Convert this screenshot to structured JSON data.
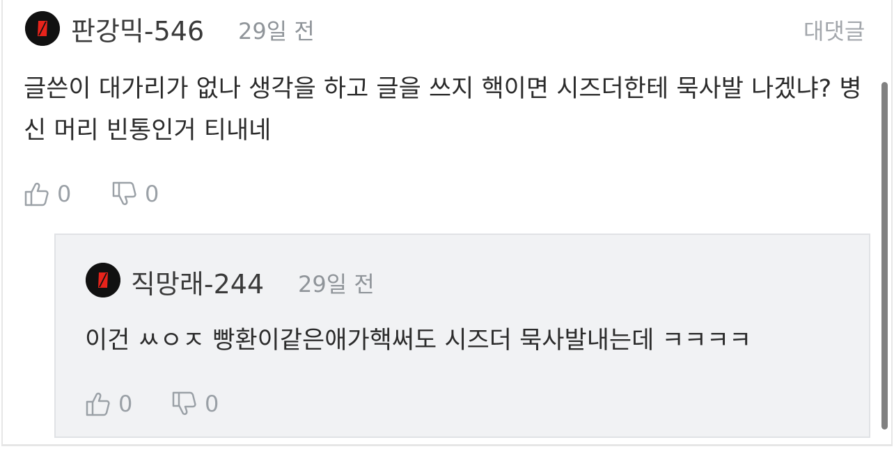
{
  "comment": {
    "author": "판강믹-546",
    "time": "29일 전",
    "reply_label": "대댓글",
    "text": "글쓴이 대가리가 없나 생각을 하고 글을 쓰지 핵이면 시즈더한테 묵사발 나겠냐? 병신 머리 빈통인거 티내네",
    "likes": "0",
    "dislikes": "0",
    "avatar_icon": "red-slash-logo-icon"
  },
  "reply": {
    "author": "직망래-244",
    "time": "29일 전",
    "text": "이건 ㅆㅇㅈ 빵환이같은애가핵써도 시즈더 묵사발내는데 ㅋㅋㅋㅋ",
    "likes": "0",
    "dislikes": "0",
    "avatar_icon": "red-slash-logo-icon"
  },
  "colors": {
    "avatar_bg": "#111111",
    "avatar_mark": "#e8231b",
    "reply_bg": "#f1f2f4",
    "muted_text": "#9aa0a6"
  }
}
